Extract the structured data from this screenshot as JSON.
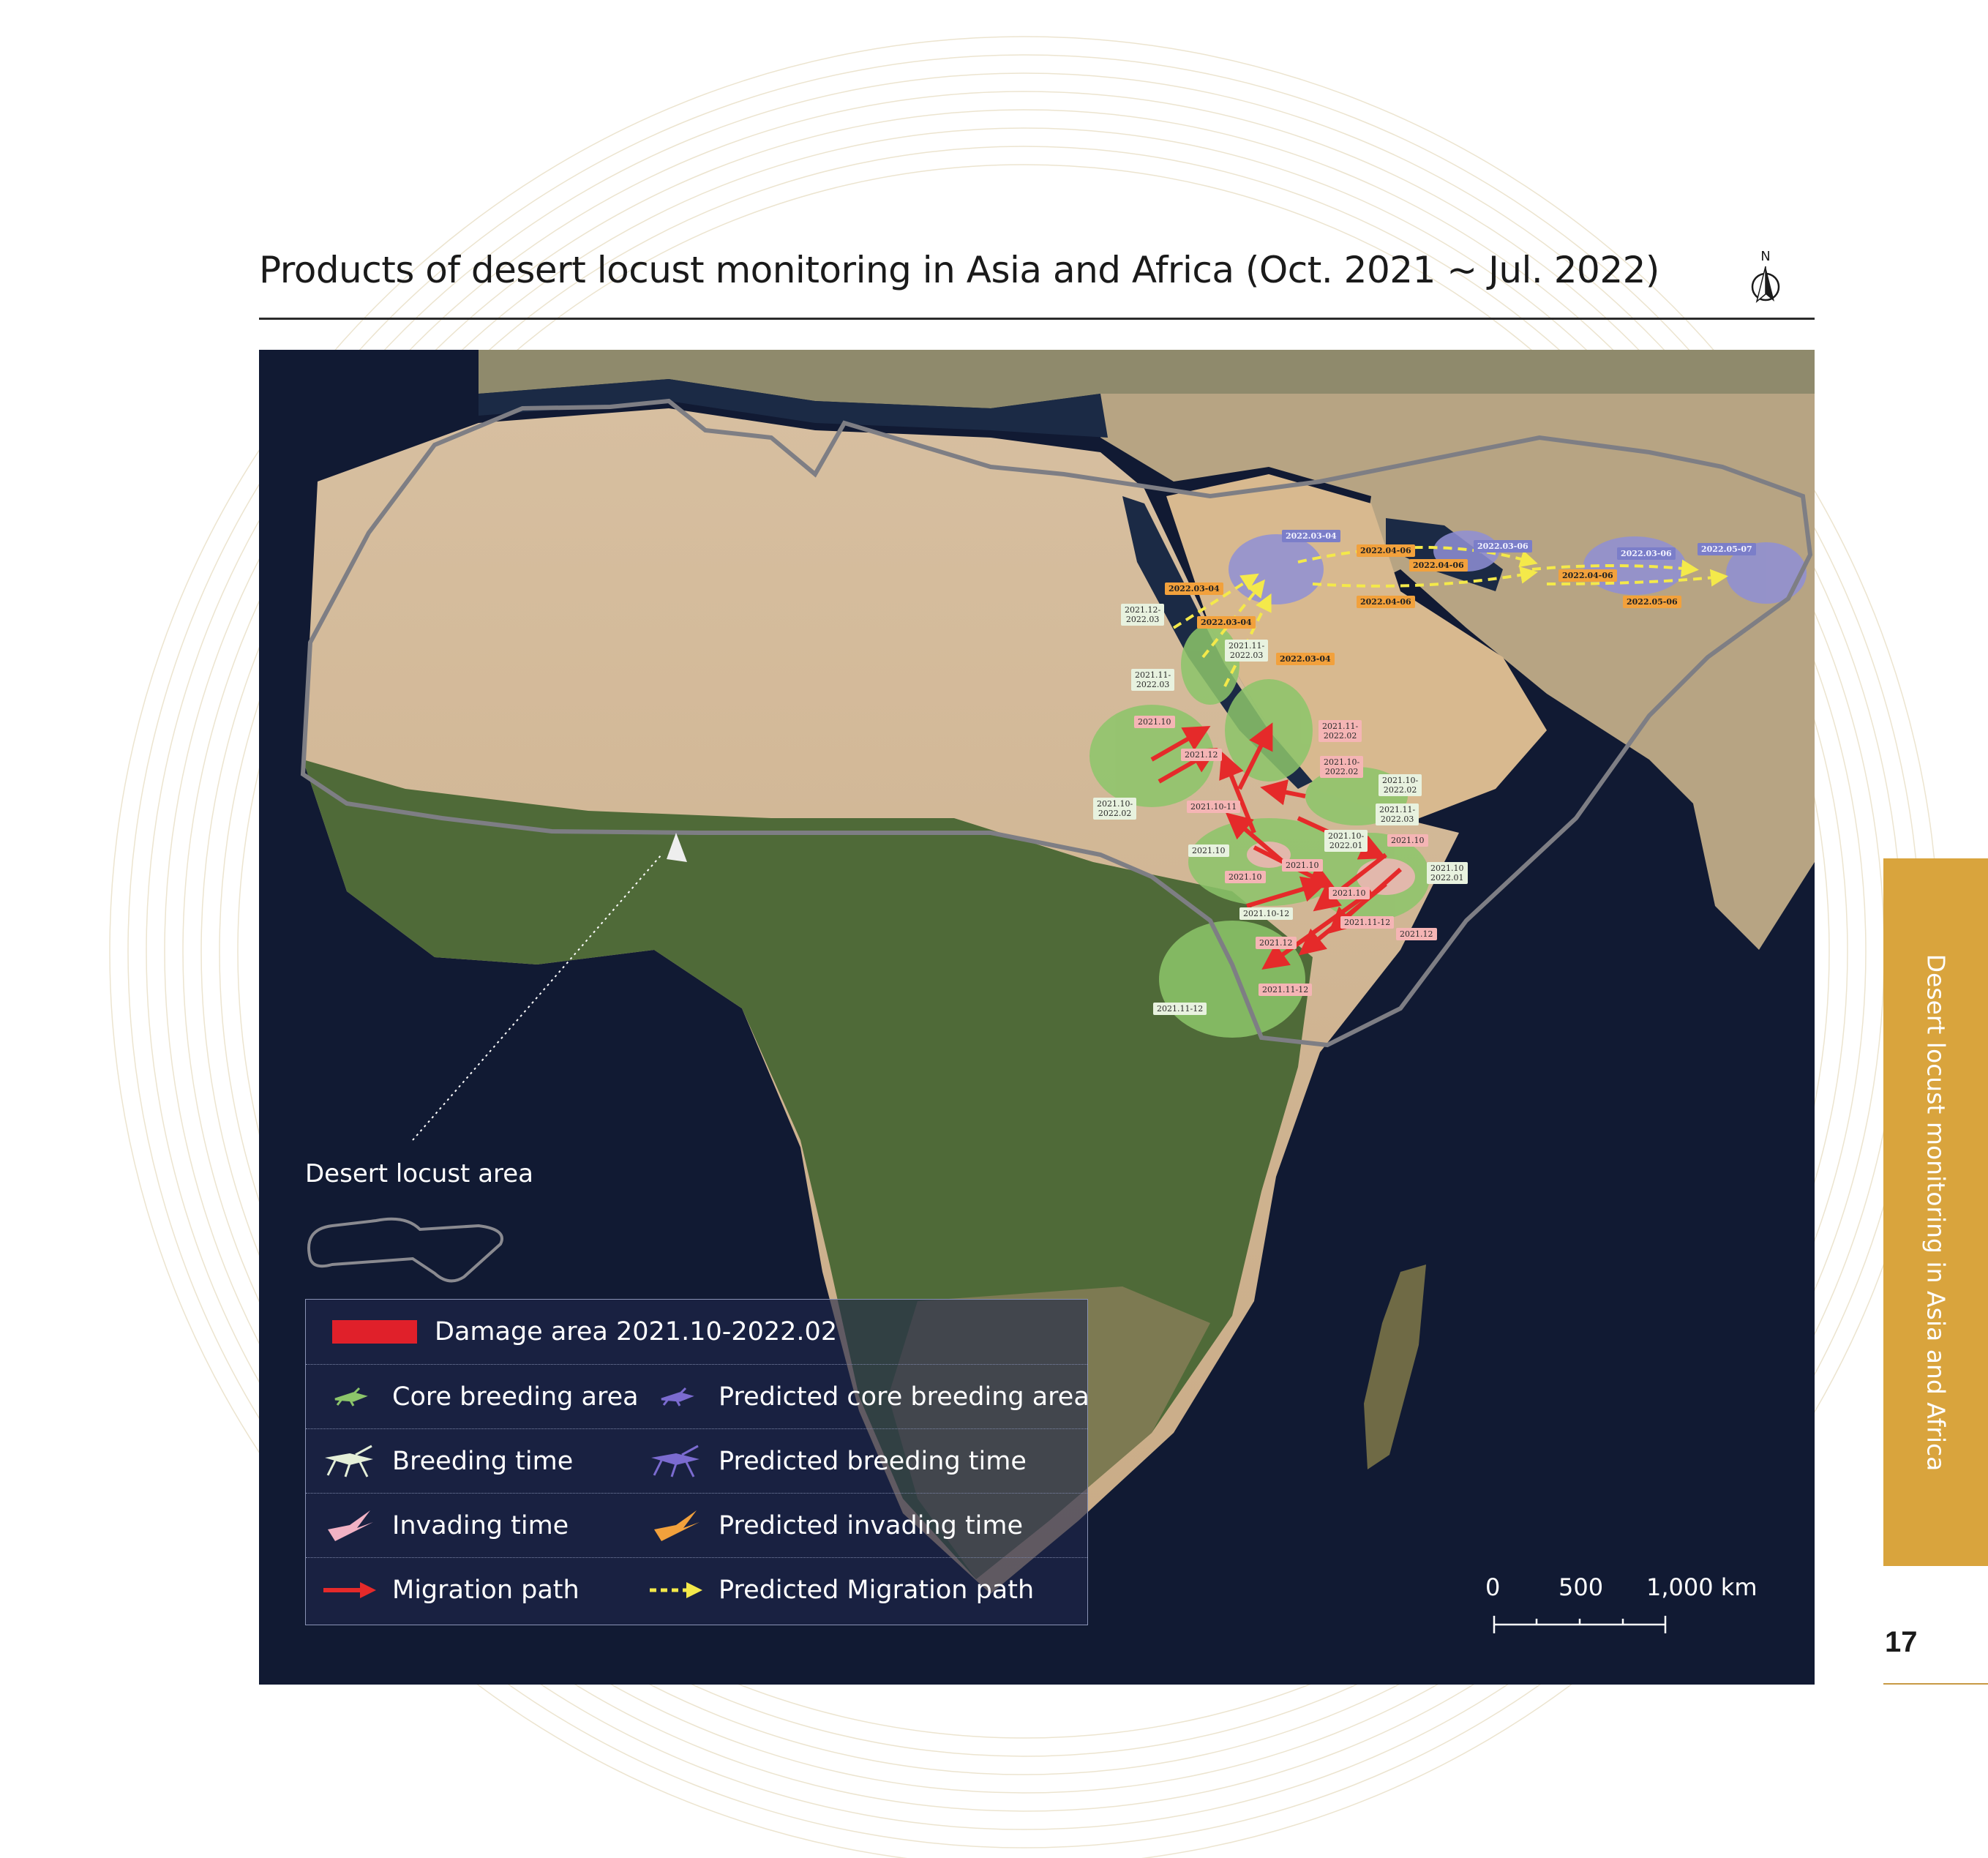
{
  "title": "Products of desert locust monitoring in Asia and Africa (Oct. 2021 ~ Jul. 2022)",
  "north_arrow_label": "N",
  "map": {
    "labels_green": [
      "2021.12-\n2022.03",
      "2021.11-\n2022.03",
      "2021.11-\n2022.03",
      "2021.10-\n2022.02",
      "2021.10",
      "2021.10-\n2022.02",
      "2021.10-\n2022.01",
      "2021.11-\n2022.03",
      "2021.10\n2022.01",
      "2021.10-12",
      "2021.11-12"
    ],
    "labels_pink": [
      "2021.10",
      "2021.12",
      "2021.10-11",
      "2021.11-\n2022.02",
      "2021.10-\n2022.02",
      "2021.10",
      "2021.10",
      "2021.10",
      "2021.10",
      "2021.11-12",
      "2021.12",
      "2021.12",
      "2021.11-12"
    ],
    "labels_orange": [
      "2022.03-04",
      "2022.03-04",
      "2022.03-04",
      "2022.04-06",
      "2022.04-06",
      "2022.04-06",
      "2022.04-06",
      "2022.05-06"
    ],
    "labels_purple": [
      "2022.03-04",
      "2022.03-06",
      "2022.03-06",
      "2022.05-07"
    ]
  },
  "area_caption": "Desert locust area",
  "legend": {
    "damage": "Damage area 2021.10-2022.02",
    "core": "Core breeding area",
    "pred_core": "Predicted core breeding area",
    "breeding": "Breeding time",
    "pred_breeding": "Predicted breeding time",
    "invading": "Invading time",
    "pred_invading": "Predicted invading time",
    "migration": "Migration path",
    "pred_migration": "Predicted Migration path",
    "icons": [
      "locust-green-icon",
      "locust-purple-icon",
      "grasshopper-white-icon",
      "grasshopper-purple-icon",
      "flying-locust-pink-icon",
      "flying-locust-orange-icon",
      "red-arrow-icon",
      "yellow-dashed-arrow-icon"
    ]
  },
  "scale": {
    "t0": "0",
    "t1": "500",
    "t2": "1,000 km"
  },
  "side_tab": "Desert locust monitoring in Asia and Africa",
  "page_number": "17",
  "colors": {
    "accent": "#d9a43d",
    "damage": "#e0202a",
    "core": "#8cc56a",
    "predicted": "#8f8fd6",
    "migration": "#e52a2a",
    "predicted_migration": "#f4e94a"
  }
}
